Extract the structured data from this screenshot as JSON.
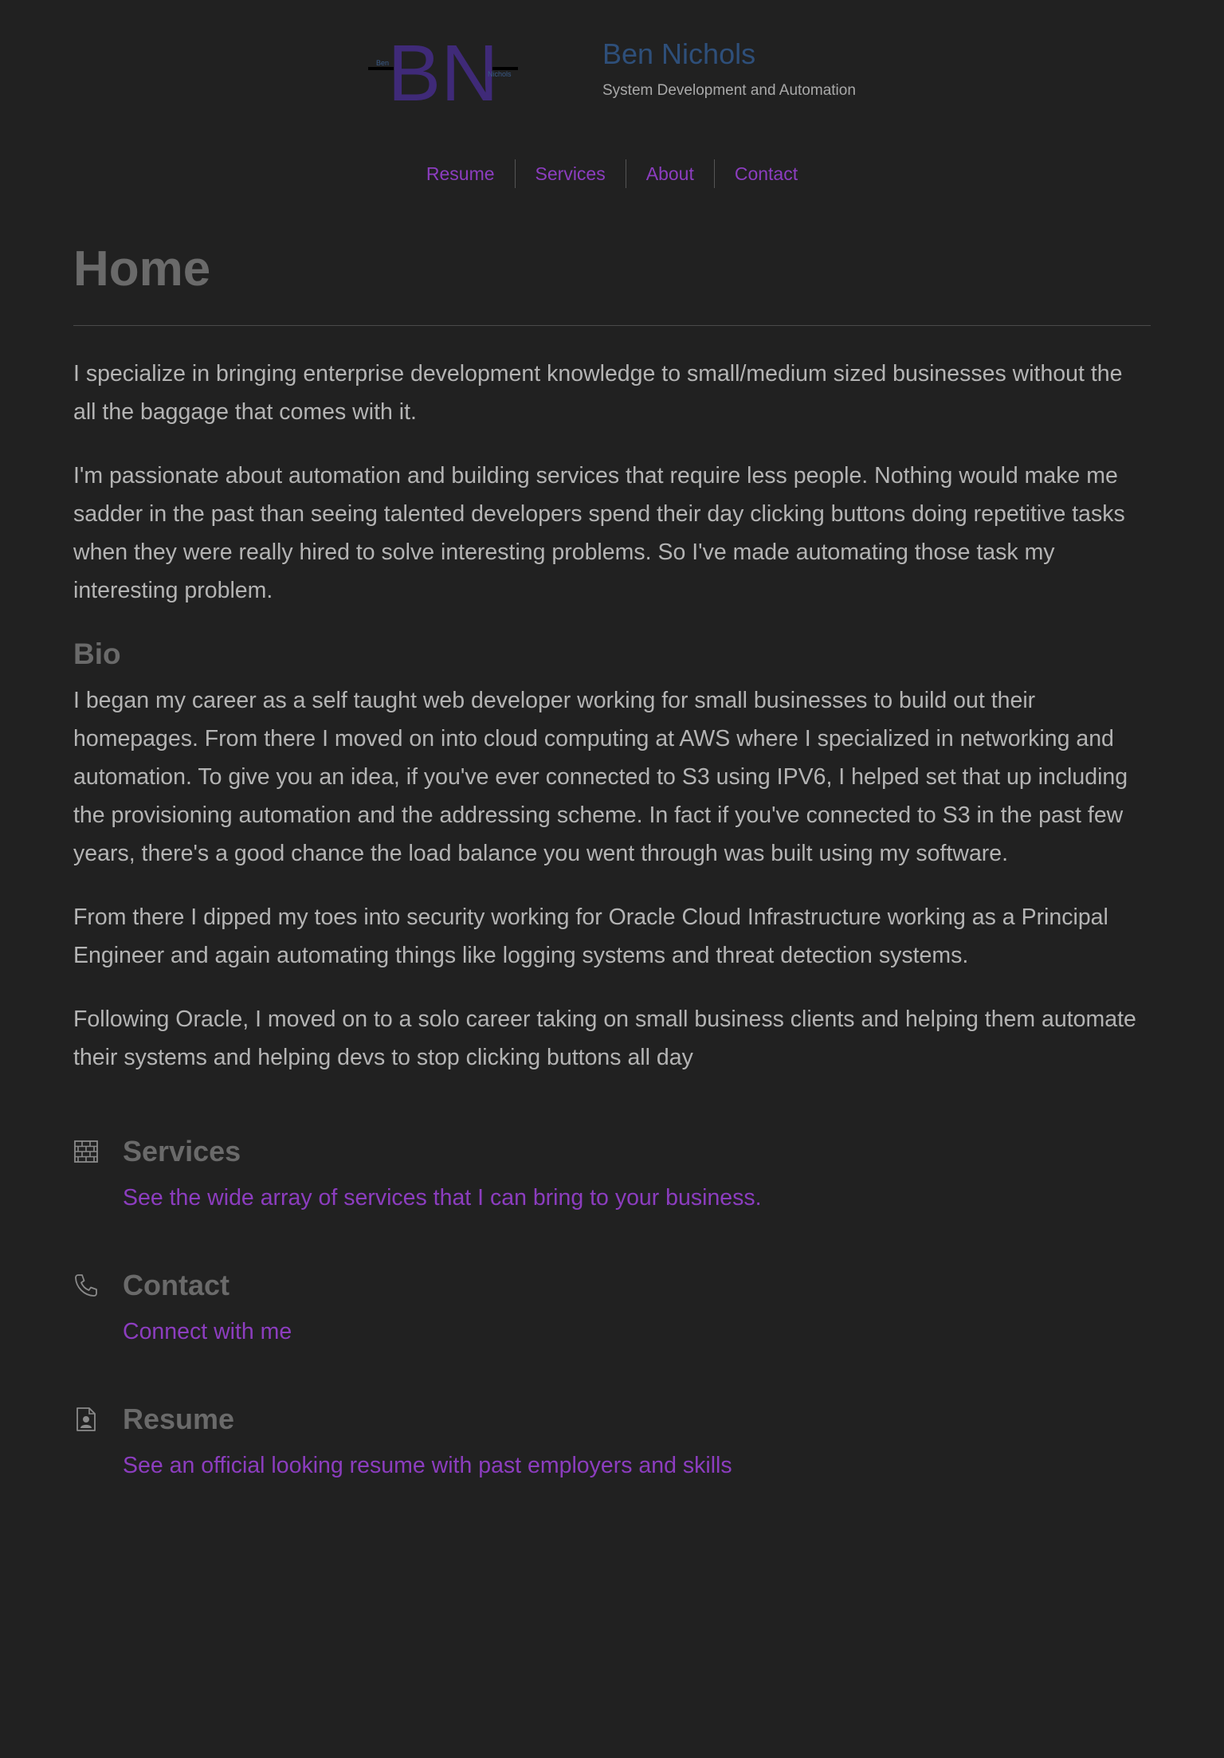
{
  "header": {
    "logo": {
      "letters": "BN",
      "small_left": "Ben",
      "small_right": "Nichols"
    },
    "name": "Ben Nichols",
    "tagline": "System Development and Automation"
  },
  "nav": {
    "items": [
      {
        "label": "Resume"
      },
      {
        "label": "Services"
      },
      {
        "label": "About"
      },
      {
        "label": "Contact"
      }
    ]
  },
  "main": {
    "title": "Home",
    "intro": [
      "I specialize in bringing enterprise development knowledge to small/medium sized businesses without the all the baggage that comes with it.",
      "I'm passionate about automation and building services that require less people. Nothing would make me sadder in the past than seeing talented developers spend their day clicking buttons doing repetitive tasks when they were really hired to solve interesting problems. So I've made automating those task my interesting problem."
    ],
    "bio_heading": "Bio",
    "bio": [
      "I began my career as a self taught web developer working for small businesses to build out their homepages. From there I moved on into cloud computing at AWS where I specialized in networking and automation. To give you an idea, if you've ever connected to S3 using IPV6, I helped set that up including the provisioning automation and the addressing scheme. In fact if you've connected to S3 in the past few years, there's a good chance the load balance you went through was built using my software.",
      "From there I dipped my toes into security working for Oracle Cloud Infrastructure working as a Principal Engineer and again automating things like logging systems and threat detection systems.",
      "Following Oracle, I moved on to a solo career taking on small business clients and helping them automate their systems and helping devs to stop clicking buttons all day"
    ]
  },
  "cards": [
    {
      "icon": "brick-wall-icon",
      "title": "Services",
      "link": "See the wide array of services that I can bring to your business."
    },
    {
      "icon": "phone-icon",
      "title": "Contact",
      "link": "Connect with me"
    },
    {
      "icon": "person-document-icon",
      "title": "Resume",
      "link": "See an official looking resume with past employers and skills"
    }
  ],
  "colors": {
    "background": "#212121",
    "accent": "#8c3dbf",
    "logo": "#3f2a78",
    "brand_name": "#2e4f7a",
    "heading": "#6a6a6a",
    "body_text": "#b4b4b4"
  }
}
